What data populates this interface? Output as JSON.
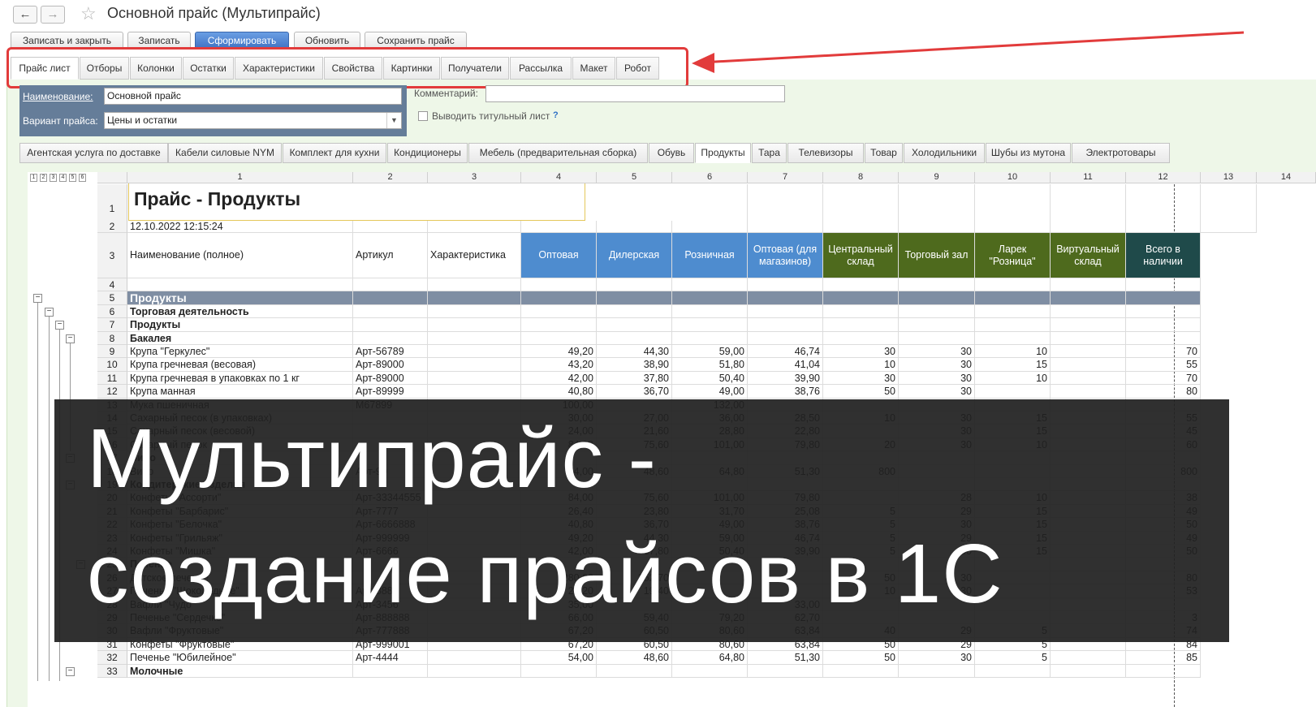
{
  "window": {
    "title": "Основной прайс (Мультипрайс)",
    "back_icon": "←",
    "forward_icon": "→",
    "star_icon": "☆"
  },
  "toolbar": {
    "buttons": [
      {
        "label": "Записать и закрыть"
      },
      {
        "label": "Записать"
      },
      {
        "label": "Сформировать"
      },
      {
        "label": "Обновить"
      },
      {
        "label": "Сохранить прайс"
      }
    ]
  },
  "tabs": [
    {
      "label": "Прайс лист"
    },
    {
      "label": "Отборы"
    },
    {
      "label": "Колонки"
    },
    {
      "label": "Остатки"
    },
    {
      "label": "Характеристики"
    },
    {
      "label": "Свойства"
    },
    {
      "label": "Картинки"
    },
    {
      "label": "Получатели"
    },
    {
      "label": "Рассылка"
    },
    {
      "label": "Макет"
    },
    {
      "label": "Робот"
    }
  ],
  "form": {
    "name_label": "Наименование:",
    "name_value": "Основной прайс",
    "variant_label": "Вариант прайса:",
    "variant_value": "Цены и остатки",
    "comment_label": "Комментарий:",
    "comment_value": "",
    "title_sheet_label": "Выводить титульный лист",
    "help_icon": "?"
  },
  "category_tabs": [
    {
      "label": "Агентская услуга по доставке"
    },
    {
      "label": "Кабели силовые NYM"
    },
    {
      "label": "Комплект для кухни"
    },
    {
      "label": "Кондиционеры"
    },
    {
      "label": "Мебель (предварительная сборка)"
    },
    {
      "label": "Обувь"
    },
    {
      "label": "Продукты"
    },
    {
      "label": "Тара"
    },
    {
      "label": "Телевизоры"
    },
    {
      "label": "Товар"
    },
    {
      "label": "Холодильники"
    },
    {
      "label": "Шубы из мутона"
    },
    {
      "label": "Электротовары"
    }
  ],
  "sheet": {
    "outline_levels": [
      "1",
      "2",
      "3",
      "4",
      "5",
      "6"
    ],
    "col_headers": [
      "1",
      "2",
      "3",
      "4",
      "5",
      "6",
      "7",
      "8",
      "9",
      "10",
      "11",
      "12",
      "13",
      "14"
    ],
    "title": "Прайс - Продукты",
    "date": "12.10.2022 12:15:24",
    "headers": [
      "Наименование (полное)",
      "Артикул",
      "Характеристика",
      "Оптовая",
      "Дилерская",
      "Розничная",
      "Оптовая (для магазинов)",
      "Центральный склад",
      "Торговый зал",
      "Ларек \"Розница\"",
      "Виртуальный склад",
      "Всего в наличии"
    ],
    "header_colors": [
      "#ffffff",
      "#ffffff",
      "#ffffff",
      "#4e8ccf",
      "#4e8ccf",
      "#4e8ccf",
      "#4e8ccf",
      "#4e6a1d",
      "#4e6a1d",
      "#4e6a1d",
      "#4e6a1d",
      "#1f4a4a"
    ],
    "group_color": "#7f8ea3",
    "rows": [
      {
        "n": "4",
        "cells": [
          "",
          "",
          "",
          "",
          "",
          "",
          "",
          "",
          "",
          "",
          "",
          ""
        ]
      },
      {
        "n": "5",
        "group": "top",
        "cells": [
          "Продукты",
          "",
          "",
          "",
          "",
          "",
          "",
          "",
          "",
          "",
          "",
          ""
        ]
      },
      {
        "n": "6",
        "group": "sub",
        "cells": [
          "Торговая деятельность",
          "",
          "",
          "",
          "",
          "",
          "",
          "",
          "",
          "",
          "",
          ""
        ]
      },
      {
        "n": "7",
        "group": "sub",
        "cells": [
          "Продукты",
          "",
          "",
          "",
          "",
          "",
          "",
          "",
          "",
          "",
          "",
          ""
        ]
      },
      {
        "n": "8",
        "group": "sub",
        "cells": [
          "Бакалея",
          "",
          "",
          "",
          "",
          "",
          "",
          "",
          "",
          "",
          "",
          ""
        ]
      },
      {
        "n": "9",
        "cells": [
          "Крупа \"Геркулес\"",
          "Арт-56789",
          "",
          "49,20",
          "44,30",
          "59,00",
          "46,74",
          "30",
          "30",
          "10",
          "",
          "70"
        ]
      },
      {
        "n": "10",
        "cells": [
          "Крупа гречневая (весовая)",
          "Арт-89000",
          "",
          "43,20",
          "38,90",
          "51,80",
          "41,04",
          "10",
          "30",
          "15",
          "",
          "55"
        ]
      },
      {
        "n": "11",
        "cells": [
          "Крупа гречневая в упаковках по 1 кг",
          "Арт-89000",
          "",
          "42,00",
          "37,80",
          "50,40",
          "39,90",
          "30",
          "30",
          "10",
          "",
          "70"
        ]
      },
      {
        "n": "12",
        "cells": [
          "Крупа манная",
          "Арт-89999",
          "",
          "40,80",
          "36,70",
          "49,00",
          "38,76",
          "50",
          "30",
          "",
          "",
          "80"
        ]
      },
      {
        "n": "13",
        "cells": [
          "Мука пшеничная",
          "М67899",
          "",
          "100,00",
          "",
          "132,00",
          "",
          "",
          "",
          "",
          "",
          ""
        ]
      },
      {
        "n": "14",
        "cells": [
          "Сахарный песок (в упаковках)",
          "",
          "",
          "30,00",
          "27,00",
          "36,00",
          "28,50",
          "10",
          "30",
          "15",
          "",
          "55"
        ]
      },
      {
        "n": "15",
        "cells": [
          "Сахарный песок (весовой)",
          "",
          "",
          "24,00",
          "21,60",
          "28,80",
          "22,80",
          "",
          "30",
          "15",
          "",
          "45"
        ]
      },
      {
        "n": "16",
        "cells": [
          "Сахарный песок",
          "",
          "",
          "84,00",
          "75,60",
          "101,00",
          "79,80",
          "20",
          "30",
          "10",
          "",
          "60"
        ]
      },
      {
        "n": "17",
        "group": "sub",
        "cells": [
          "Вино",
          "",
          "",
          "",
          "",
          "",
          "",
          "",
          "",
          "",
          "",
          ""
        ]
      },
      {
        "n": "18",
        "cells": [
          "Вино",
          "Арт-90",
          "",
          "54,00",
          "48,60",
          "64,80",
          "51,30",
          "800",
          "",
          "",
          "",
          "800"
        ]
      },
      {
        "n": "19",
        "group": "sub",
        "cells": [
          "Кондитерские изделия",
          "",
          "",
          "",
          "",
          "",
          "",
          "",
          "",
          "",
          "",
          ""
        ]
      },
      {
        "n": "20",
        "cells": [
          "Конфеты \"Ассорти\"",
          "Арт-33344555",
          "",
          "84,00",
          "75,60",
          "101,00",
          "79,80",
          "",
          "28",
          "10",
          "",
          "38"
        ]
      },
      {
        "n": "21",
        "cells": [
          "Конфеты \"Барбарис\"",
          "Арт-7777",
          "",
          "26,40",
          "23,80",
          "31,70",
          "25,08",
          "5",
          "29",
          "15",
          "",
          "49"
        ]
      },
      {
        "n": "22",
        "cells": [
          "Конфеты \"Белочка\"",
          "Арт-6666888",
          "",
          "40,80",
          "36,70",
          "49,00",
          "38,76",
          "5",
          "30",
          "15",
          "",
          "50"
        ]
      },
      {
        "n": "23",
        "cells": [
          "Конфеты \"Грильяж\"",
          "Арт-999999",
          "",
          "49,20",
          "44,30",
          "59,00",
          "46,74",
          "5",
          "29",
          "15",
          "",
          "49"
        ]
      },
      {
        "n": "24",
        "cells": [
          "Конфеты \"Мишка\"",
          "Арт-6666",
          "",
          "42,00",
          "37,80",
          "50,40",
          "39,90",
          "5",
          "30",
          "15",
          "",
          "50"
        ]
      },
      {
        "n": "25",
        "group": "sub",
        "cells": [
          "Печенье",
          "",
          "",
          "",
          "",
          "",
          "",
          "",
          "",
          "",
          "",
          ""
        ]
      },
      {
        "n": "26",
        "cells": [
          "Детское печенье",
          "",
          "",
          "280,00",
          "252,70",
          "",
          "",
          "50",
          "30",
          "",
          "",
          "80"
        ]
      },
      {
        "n": "27",
        "cells": [
          "Печенье \"Шоколадное\"",
          "Арт-8888",
          "",
          "21,20",
          "19,40",
          "",
          "",
          "10",
          "30",
          "",
          "",
          "53"
        ]
      },
      {
        "n": "28",
        "cells": [
          "Вафли \"Чудо\"",
          "Арт-3456",
          "",
          "35,00",
          "",
          "",
          "33,00",
          "",
          "",
          "",
          "",
          ""
        ]
      },
      {
        "n": "29",
        "cells": [
          "Печенье \"Сердечко\"",
          "Арт-888888",
          "",
          "66,00",
          "59,40",
          "79,20",
          "62,70",
          "",
          "",
          "",
          "",
          "3"
        ]
      },
      {
        "n": "30",
        "cells": [
          "Вафли \"Фруктовые\"",
          "Арт-777888",
          "",
          "67,20",
          "60,50",
          "80,60",
          "63,84",
          "40",
          "29",
          "5",
          "",
          "74"
        ]
      },
      {
        "n": "31",
        "cells": [
          "Конфеты \"Фруктовые\"",
          "Арт-999001",
          "",
          "67,20",
          "60,50",
          "80,60",
          "63,84",
          "50",
          "29",
          "5",
          "",
          "84"
        ]
      },
      {
        "n": "32",
        "cells": [
          "Печенье \"Юбилейное\"",
          "Арт-4444",
          "",
          "54,00",
          "48,60",
          "64,80",
          "51,30",
          "50",
          "30",
          "5",
          "",
          "85"
        ]
      },
      {
        "n": "33",
        "group": "sub",
        "cells": [
          "Молочные",
          "",
          "",
          "",
          "",
          "",
          "",
          "",
          "",
          "",
          "",
          ""
        ]
      }
    ]
  },
  "banner": {
    "line1": "Мультипрайс -",
    "line2": "создание прайсов в 1С"
  },
  "annotation_color": "#e23b3b"
}
